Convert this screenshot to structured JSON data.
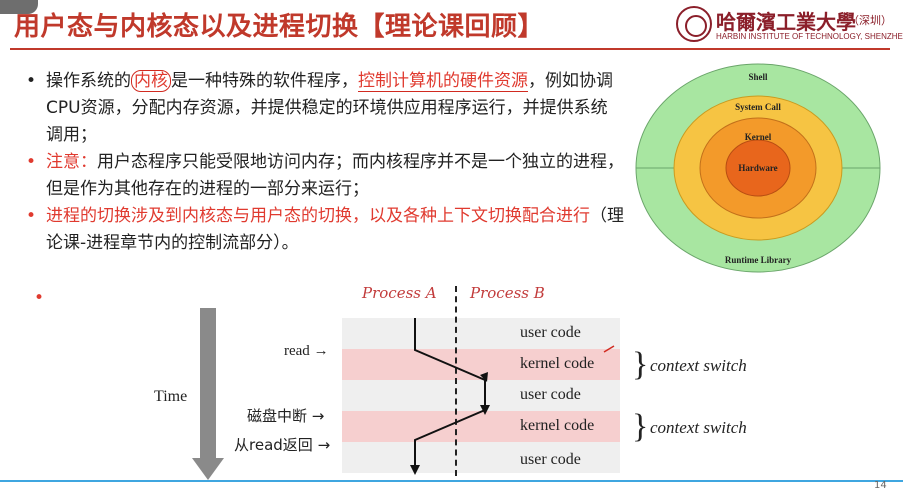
{
  "slide": {
    "title": "用户态与内核态以及进程切换【理论课回顾】",
    "logo": {
      "name_cn": "哈爾濱工業大學",
      "campus": "（深圳）",
      "name_en": "HARBIN INSTITUTE OF TECHNOLOGY, SHENZHEN"
    },
    "page_number": "14"
  },
  "bullets": {
    "b1": {
      "p1": "操作系统的",
      "p2": "内核",
      "p3": "是一种特殊的软件程序，",
      "p4": "控制计算机的硬件资源",
      "p5": "，例如协调CPU资源，分配内存资源，并提供稳定的环境供应用程序运行，并提供系统调用；"
    },
    "b2": {
      "p1": "注意：",
      "p2": "用户态程序只能受限地访问内存；而内核程序并不是一个独立的进程，但是作为其他存在的进程的一部分来运行；"
    },
    "b3": {
      "p1": "进程的切换涉及到内核态与用户态的切换，以及各种上下文切换配合进行",
      "p2": "（理论课-进程章节内的控制流部分）。"
    },
    "dot": "•"
  },
  "rings": {
    "shell": "Shell",
    "system_call": "System Call",
    "kernel": "Kernel",
    "hardware": "Hardware",
    "runtime_library": "Runtime Library"
  },
  "flow": {
    "process_a": "Process A",
    "process_b": "Process B",
    "time": "Time",
    "rows": [
      "user code",
      "kernel code",
      "user code",
      "kernel code",
      "user code"
    ],
    "events": {
      "read": "read",
      "disk_interrupt": "磁盘中断",
      "return_from_read": "从read返回",
      "arrow": "→"
    },
    "context_switch": "context switch",
    "brace": "}"
  },
  "colors": {
    "title_red": "#c0392b",
    "accent_red": "#e03a2f",
    "ring_outer": "#a8e6a1",
    "ring_syscall": "#f6c443",
    "ring_kernel": "#f39a2a",
    "ring_hardware": "#e8661c",
    "pink_row": "#f6cfcf",
    "gray_row": "#efefef",
    "bottom_line": "#3fa6e0"
  }
}
